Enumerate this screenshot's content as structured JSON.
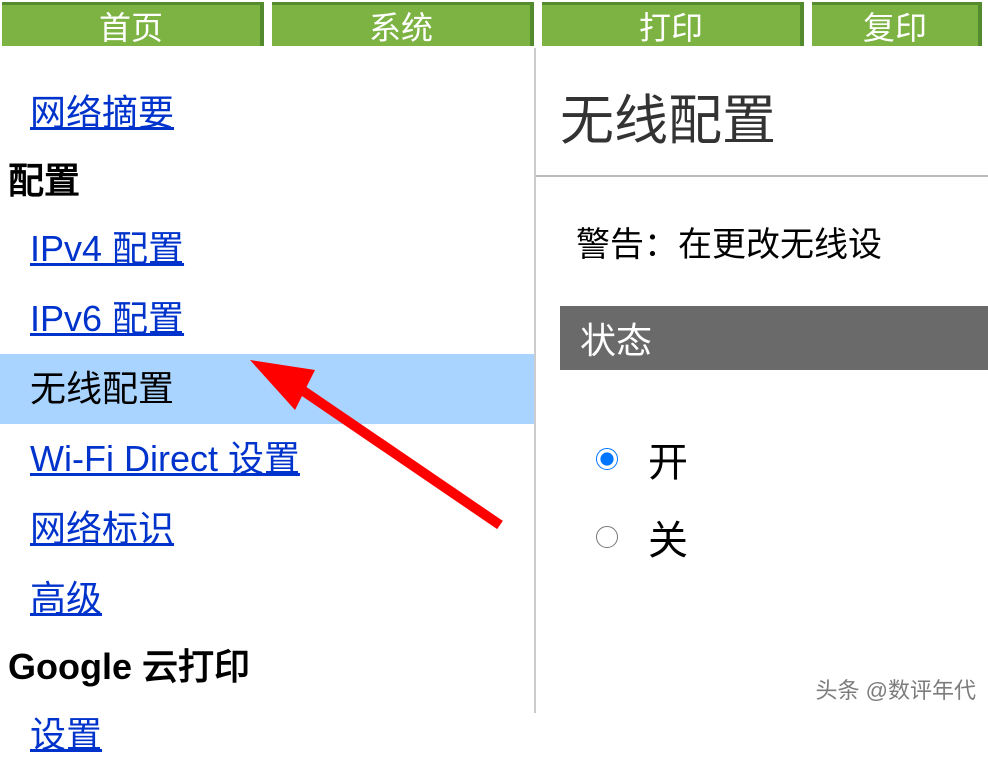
{
  "tabs": {
    "home": "首页",
    "system": "系统",
    "print": "打印",
    "copy": "复印"
  },
  "sidebar": {
    "network_summary": "网络摘要",
    "config_heading": "配置",
    "ipv4_config": "IPv4 配置",
    "ipv6_config": "IPv6 配置",
    "wireless_config": "无线配置",
    "wifi_direct": "Wi-Fi Direct 设置",
    "network_id": "网络标识",
    "advanced": "高级",
    "google_cloud_print_heading": "Google 云打印",
    "settings": "设置"
  },
  "main": {
    "title": "无线配置",
    "warning": "警告：在更改无线设",
    "status_header": "状态",
    "radio_on": "开",
    "radio_off": "关"
  },
  "watermark": "头条 @数评年代"
}
